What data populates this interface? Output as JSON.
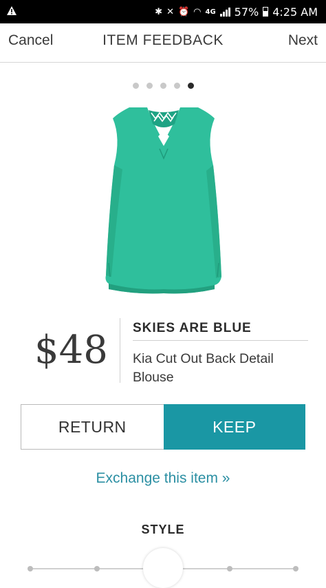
{
  "status_bar": {
    "signal_label": "4G",
    "battery": "57%",
    "time": "4:25 AM",
    "icons": [
      "warning-icon",
      "bluetooth-icon",
      "mute-icon",
      "alarm-icon",
      "wifi-icon",
      "signal-icon",
      "battery-icon"
    ]
  },
  "header": {
    "cancel_label": "Cancel",
    "title": "ITEM FEEDBACK",
    "next_label": "Next"
  },
  "pager": {
    "count": 5,
    "active_index": 4
  },
  "product": {
    "image_icon": "sleeveless-blouse-image",
    "price": "$48",
    "brand": "SKIES ARE BLUE",
    "name": "Kia Cut Out Back Detail Blouse",
    "color": "#2fbf9c"
  },
  "actions": {
    "return_label": "RETURN",
    "keep_label": "KEEP",
    "selected": "KEEP",
    "exchange_label": "Exchange this item »"
  },
  "style_section": {
    "title": "STYLE",
    "slider_ticks": 5,
    "slider_value_fraction": 0.5
  },
  "colors": {
    "accent": "#1a97a4",
    "link": "#2b8fa3"
  }
}
